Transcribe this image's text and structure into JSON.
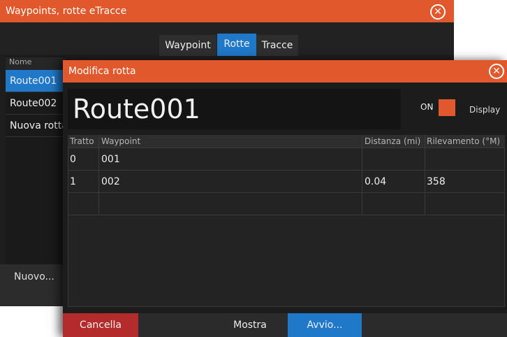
{
  "background_window": {
    "title": "Waypoints, rotte eTracce",
    "tabs": [
      "Waypoint",
      "Rotte",
      "Tracce"
    ],
    "active_tab": "Rotte",
    "list_header": "Nome",
    "list_items": [
      "Route001",
      "Route002",
      "Nuova rotta"
    ],
    "new_button": "Nuovo..."
  },
  "dialog": {
    "title": "Modifica rotta",
    "route_name": "Route001",
    "toggle_state": "ON",
    "toggle_label": "Display",
    "table": {
      "headers": [
        "Tratto",
        "Waypoint",
        "Distanza (mi)",
        "Rilevamento (°M)"
      ],
      "rows": [
        [
          "0",
          "001",
          "",
          ""
        ],
        [
          "1",
          "002",
          "0.04",
          "358"
        ]
      ]
    },
    "buttons": {
      "cancel": "Cancella",
      "show": "Mostra",
      "start": "Avvio..."
    }
  },
  "colors": {
    "title_bar": "#e0582b",
    "selection": "#1f78c8",
    "cancel": "#b32b2b"
  }
}
